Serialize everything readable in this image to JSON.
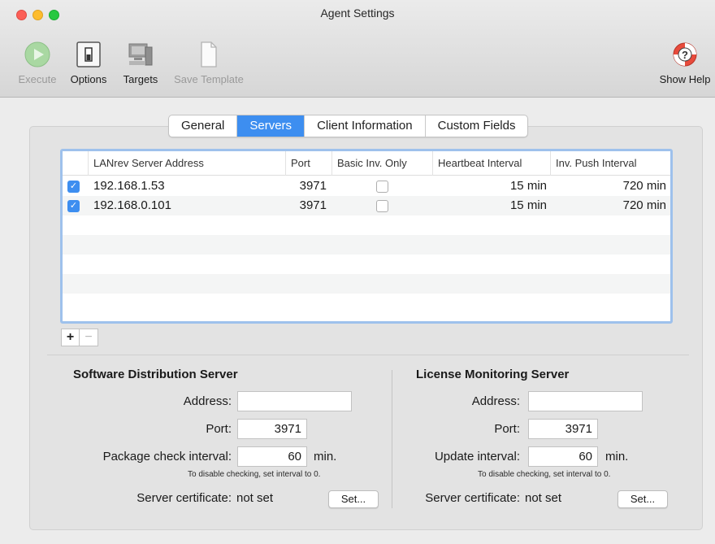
{
  "window": {
    "title": "Agent Settings"
  },
  "toolbar": {
    "execute": "Execute",
    "options": "Options",
    "targets": "Targets",
    "save_template": "Save Template",
    "show_help": "Show Help"
  },
  "tabs": [
    {
      "label": "General",
      "active": false
    },
    {
      "label": "Servers",
      "active": true
    },
    {
      "label": "Client Information",
      "active": false
    },
    {
      "label": "Custom Fields",
      "active": false
    }
  ],
  "table": {
    "columns": [
      "LANrev Server Address",
      "Port",
      "Basic Inv. Only",
      "Heartbeat Interval",
      "Inv. Push Interval"
    ],
    "rows": [
      {
        "enabled": true,
        "address": "192.168.1.53",
        "port": "3971",
        "basic_inv_only": false,
        "heartbeat": "15 min",
        "push": "720 min"
      },
      {
        "enabled": true,
        "address": "192.168.0.101",
        "port": "3971",
        "basic_inv_only": false,
        "heartbeat": "15 min",
        "push": "720 min"
      }
    ]
  },
  "list_buttons": {
    "add": "+",
    "remove": "−"
  },
  "sds": {
    "title": "Software Distribution Server",
    "address_label": "Address:",
    "address_value": "",
    "port_label": "Port:",
    "port_value": "3971",
    "interval_label": "Package check interval:",
    "interval_value": "60",
    "unit": "min.",
    "hint": "To disable checking, set interval to 0.",
    "cert_label": "Server certificate:",
    "cert_value": "not set",
    "set_button": "Set..."
  },
  "lms": {
    "title": "License Monitoring Server",
    "address_label": "Address:",
    "address_value": "",
    "port_label": "Port:",
    "port_value": "3971",
    "interval_label": "Update interval:",
    "interval_value": "60",
    "unit": "min.",
    "hint": "To disable checking, set interval to 0.",
    "cert_label": "Server certificate:",
    "cert_value": "not set",
    "set_button": "Set..."
  },
  "colors": {
    "accent": "#3d8ef0",
    "table_focus": "#9ec1ec"
  }
}
